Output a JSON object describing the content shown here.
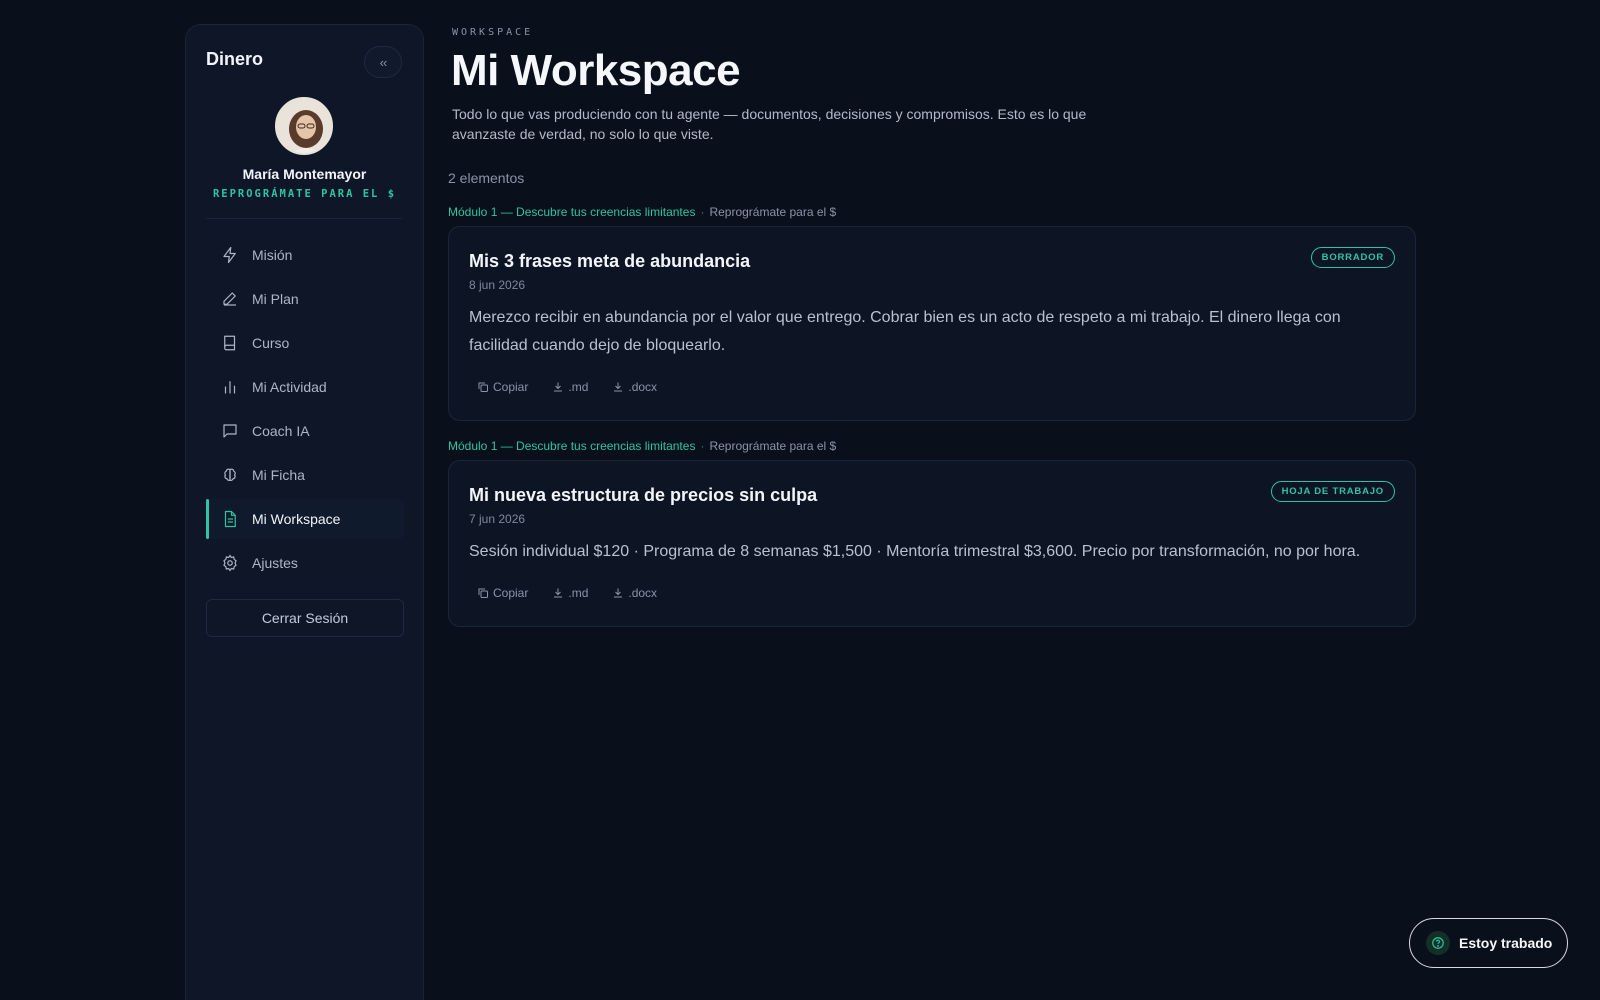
{
  "sidebar": {
    "brand": "Dinero",
    "collapse_icon": "‹‹",
    "profile": {
      "name": "María Montemayor",
      "program": "REPROGRÁMATE PARA EL $"
    },
    "items": [
      {
        "label": "Misión",
        "icon": "bolt-icon",
        "active": false
      },
      {
        "label": "Mi Plan",
        "icon": "pencil-icon",
        "active": false
      },
      {
        "label": "Curso",
        "icon": "book-icon",
        "active": false
      },
      {
        "label": "Mi Actividad",
        "icon": "bar-chart-icon",
        "active": false
      },
      {
        "label": "Coach IA",
        "icon": "chat-icon",
        "active": false
      },
      {
        "label": "Mi Ficha",
        "icon": "brain-icon",
        "active": false
      },
      {
        "label": "Mi Workspace",
        "icon": "document-icon",
        "active": true
      },
      {
        "label": "Ajustes",
        "icon": "gear-icon",
        "active": false
      }
    ],
    "logout_label": "Cerrar Sesión"
  },
  "main": {
    "eyebrow": "WORKSPACE",
    "title": "Mi Workspace",
    "description": "Todo lo que vas produciendo con tu agente — documentos, decisiones y compromisos. Esto es lo que avanzaste de verdad, no solo lo que viste.",
    "count": "2 elementos",
    "items": [
      {
        "module": "Módulo 1 — Descubre tus creencias limitantes",
        "separator": "·",
        "program": "Reprográmate para el $",
        "title": "Mis 3 frases meta de abundancia",
        "date": "8 jun 2026",
        "badge": "BORRADOR",
        "body": "Merezco recibir en abundancia por el valor que entrego. Cobrar bien es un acto de respeto a mi trabajo. El dinero llega con facilidad cuando dejo de bloquearlo.",
        "actions": {
          "copy": "Copiar",
          "md": ".md",
          "docx": ".docx"
        }
      },
      {
        "module": "Módulo 1 — Descubre tus creencias limitantes",
        "separator": "·",
        "program": "Reprográmate para el $",
        "title": "Mi nueva estructura de precios sin culpa",
        "date": "7 jun 2026",
        "badge": "HOJA DE TRABAJO",
        "body": "Sesión individual $120 · Programa de 8 semanas $1,500 · Mentoría trimestral $3,600. Precio por transformación, no por hora.",
        "actions": {
          "copy": "Copiar",
          "md": ".md",
          "docx": ".docx"
        }
      }
    ]
  },
  "help_button": {
    "label": "Estoy trabado",
    "icon": "help-circle-icon"
  },
  "colors": {
    "accent": "#2ec4a0",
    "background": "#0a0f1c",
    "panel": "#0e1627"
  }
}
